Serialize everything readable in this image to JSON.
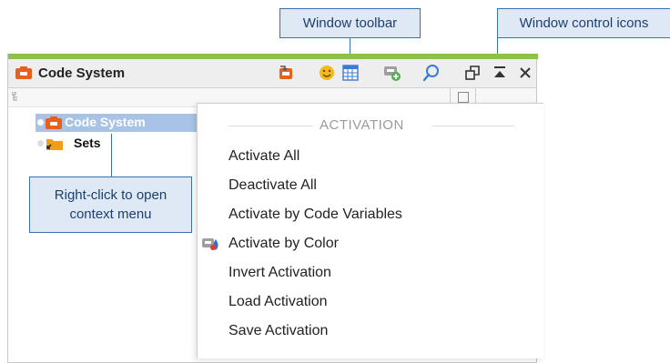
{
  "callouts": {
    "window_toolbar": "Window toolbar",
    "window_control_icons": "Window control icons",
    "right_click_line1": "Right-click to open",
    "right_click_line2": "context menu"
  },
  "window": {
    "title": "Code System",
    "accent_color": "#8bc34a",
    "toolbar_icons": [
      "retrieve-icon",
      "smiley-icon",
      "table-icon",
      "add-code-icon",
      "search-icon"
    ],
    "control_icons": [
      "undock-icon",
      "minimize-icon",
      "close-icon"
    ]
  },
  "tree": {
    "items": [
      {
        "label": "Code System",
        "selected": true
      },
      {
        "label": "Sets",
        "selected": false
      }
    ]
  },
  "context_menu": {
    "header": "ACTIVATION",
    "items": [
      {
        "label": "Activate All"
      },
      {
        "label": "Deactivate All"
      },
      {
        "label": "Activate by Code Variables"
      },
      {
        "label": "Activate by Color",
        "icon": "color-palette-icon"
      },
      {
        "label": "Invert Activation"
      },
      {
        "label": "Load Activation"
      },
      {
        "label": "Save Activation"
      }
    ]
  }
}
